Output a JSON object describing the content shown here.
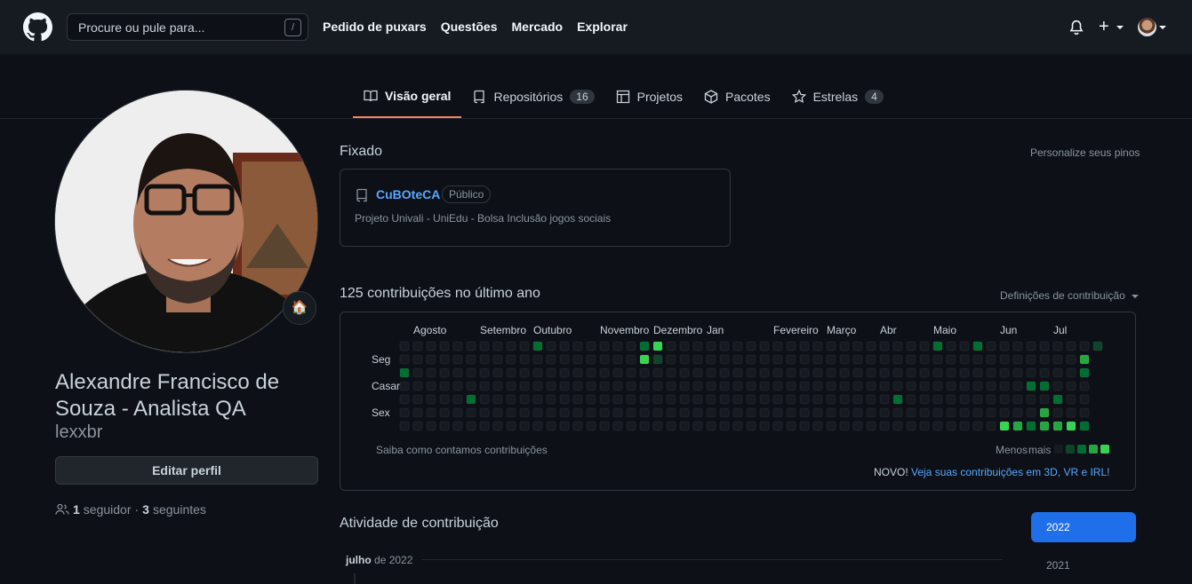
{
  "header": {
    "search_placeholder": "Procure ou pule para...",
    "search_shortcut": "/",
    "nav": [
      "Pedido de puxars",
      "Questões",
      "Mercado",
      "Explorar"
    ]
  },
  "tabs": [
    {
      "label": "Visão geral",
      "icon": "book-icon",
      "active": true
    },
    {
      "label": "Repositórios",
      "icon": "repo-icon",
      "count": "16"
    },
    {
      "label": "Projetos",
      "icon": "table-icon"
    },
    {
      "label": "Pacotes",
      "icon": "package-icon"
    },
    {
      "label": "Estrelas",
      "icon": "star-icon",
      "count": "4"
    }
  ],
  "profile": {
    "fullname": "Alexandre Francisco de Souza - Analista QA",
    "username": "lexxbr",
    "status_emoji": "🏠",
    "edit_label": "Editar perfil",
    "followers_count": "1",
    "followers_label": "seguidor",
    "separator": "·",
    "following_count": "3",
    "following_label": "seguintes"
  },
  "pinned": {
    "heading": "Fixado",
    "customize": "Personalize seus pinos",
    "repo_name": "CuBOteCA",
    "repo_visibility": "Público",
    "repo_desc": "Projeto Univali - UniEdu - Bolsa Inclusão jogos sociais"
  },
  "contributions": {
    "heading": "125 contribuições no último ano",
    "settings": "Definições de contribuição",
    "months": [
      {
        "label": "Agosto",
        "week": 1
      },
      {
        "label": "Setembro",
        "week": 6
      },
      {
        "label": "Outubro",
        "week": 10
      },
      {
        "label": "Novembro",
        "week": 15
      },
      {
        "label": "Dezembro",
        "week": 19
      },
      {
        "label": "Jan",
        "week": 23
      },
      {
        "label": "Fevereiro",
        "week": 28
      },
      {
        "label": "Março",
        "week": 32
      },
      {
        "label": "Abr",
        "week": 36
      },
      {
        "label": "Maio",
        "week": 40
      },
      {
        "label": "Jun",
        "week": 45
      },
      {
        "label": "Jul",
        "week": 49
      }
    ],
    "day_labels": [
      {
        "label": "Seg",
        "row": 1
      },
      {
        "label": "Casar",
        "row": 3
      },
      {
        "label": "Sex",
        "row": 5
      }
    ],
    "weeks": 53,
    "active_cells": [
      {
        "w": 0,
        "d": 2,
        "l": 2
      },
      {
        "w": 5,
        "d": 4,
        "l": 2
      },
      {
        "w": 10,
        "d": 0,
        "l": 2
      },
      {
        "w": 18,
        "d": 0,
        "l": 2
      },
      {
        "w": 18,
        "d": 1,
        "l": 4
      },
      {
        "w": 19,
        "d": 0,
        "l": 4
      },
      {
        "w": 19,
        "d": 1,
        "l": 1
      },
      {
        "w": 37,
        "d": 4,
        "l": 2
      },
      {
        "w": 40,
        "d": 0,
        "l": 2
      },
      {
        "w": 43,
        "d": 0,
        "l": 2
      },
      {
        "w": 45,
        "d": 6,
        "l": 4
      },
      {
        "w": 46,
        "d": 6,
        "l": 3
      },
      {
        "w": 47,
        "d": 3,
        "l": 2
      },
      {
        "w": 47,
        "d": 6,
        "l": 2
      },
      {
        "w": 48,
        "d": 3,
        "l": 2
      },
      {
        "w": 48,
        "d": 5,
        "l": 3
      },
      {
        "w": 48,
        "d": 6,
        "l": 3
      },
      {
        "w": 49,
        "d": 4,
        "l": 2
      },
      {
        "w": 49,
        "d": 6,
        "l": 3
      },
      {
        "w": 50,
        "d": 6,
        "l": 4
      },
      {
        "w": 51,
        "d": 2,
        "l": 2
      },
      {
        "w": 51,
        "d": 1,
        "l": 3
      },
      {
        "w": 51,
        "d": 6,
        "l": 2
      },
      {
        "w": 52,
        "d": 0,
        "l": 1
      }
    ],
    "learn": "Saiba como contamos contribuições",
    "less": "Menos",
    "more": "mais",
    "new_label": "NOVO!",
    "new_link": "Veja suas contribuições em 3D, VR e IRL!",
    "level_colors": [
      "#161b22",
      "#0e4429",
      "#006d32",
      "#26a641",
      "#39d353"
    ]
  },
  "activity": {
    "heading": "Atividade de contribuição",
    "month_bold": "julho",
    "month_rest": "de 2022",
    "years": [
      "2022",
      "2021"
    ]
  }
}
